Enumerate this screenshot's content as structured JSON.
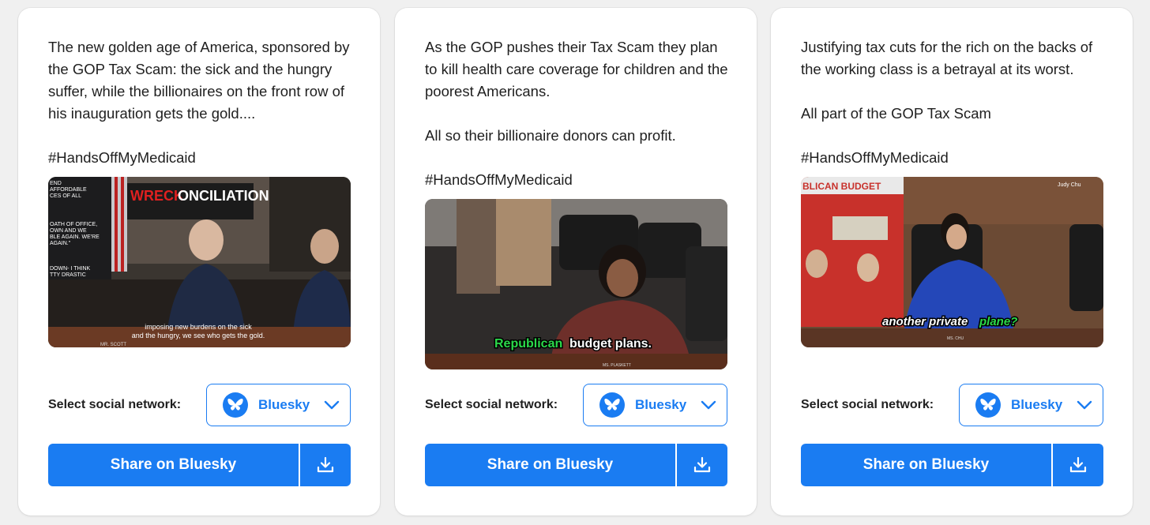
{
  "cards": [
    {
      "paragraphs": [
        "The new golden age of America, sponsored by the GOP Tax Scam: the sick and the hungry suffer, while the billionaires on the front row of his inauguration gets the gold....",
        "#HandsOffMyMedicaid"
      ],
      "video": {
        "sign_title": "WRECKONCILIATION",
        "sign_lines": [
          "END",
          "AFFORDABLE",
          "CES OF ALL",
          "OATH OF OFFICE,",
          "OWN AND WE",
          "BLE AGAIN. WE'RE",
          "AGAIN.\"",
          "DOWN- I THINK",
          "TTY DRASTIC"
        ],
        "caption_line1": "imposing new burdens on the sick",
        "caption_line2": "and the hungry, we see who gets the gold.",
        "nameplate": "MR. SCOTT"
      },
      "select_label": "Select social network:",
      "select_value": "Bluesky",
      "share_label": "Share on Bluesky"
    },
    {
      "paragraphs": [
        "As the GOP pushes their Tax Scam they plan to kill health care coverage for children and the poorest Americans.",
        "All so their billionaire donors can profit.",
        "#HandsOffMyMedicaid"
      ],
      "video": {
        "caption_highlight": "Republican",
        "caption_rest": "budget plans.",
        "nameplate": "MS. PLASKETT"
      },
      "select_label": "Select social network:",
      "select_value": "Bluesky",
      "share_label": "Share on Bluesky"
    },
    {
      "paragraphs": [
        "Justifying tax cuts for the rich on the backs of the working class is a betrayal at its worst.",
        "All part of the GOP Tax Scam",
        "#HandsOffMyMedicaid"
      ],
      "video": {
        "sign_title": "BLICAN BUDGET",
        "caption_rest": "another private",
        "caption_highlight": "plane?",
        "watermark": "Judy Chu",
        "nameplate": "MS. CHU"
      },
      "select_label": "Select social network:",
      "select_value": "Bluesky",
      "share_label": "Share on Bluesky"
    }
  ],
  "icons": {
    "network": "bluesky-butterfly-icon",
    "dropdown": "chevron-down-icon",
    "download": "download-icon"
  },
  "colors": {
    "accent": "#1a7cf2",
    "page_bg": "#f0f0f0",
    "caption_green": "#2bd94a"
  }
}
